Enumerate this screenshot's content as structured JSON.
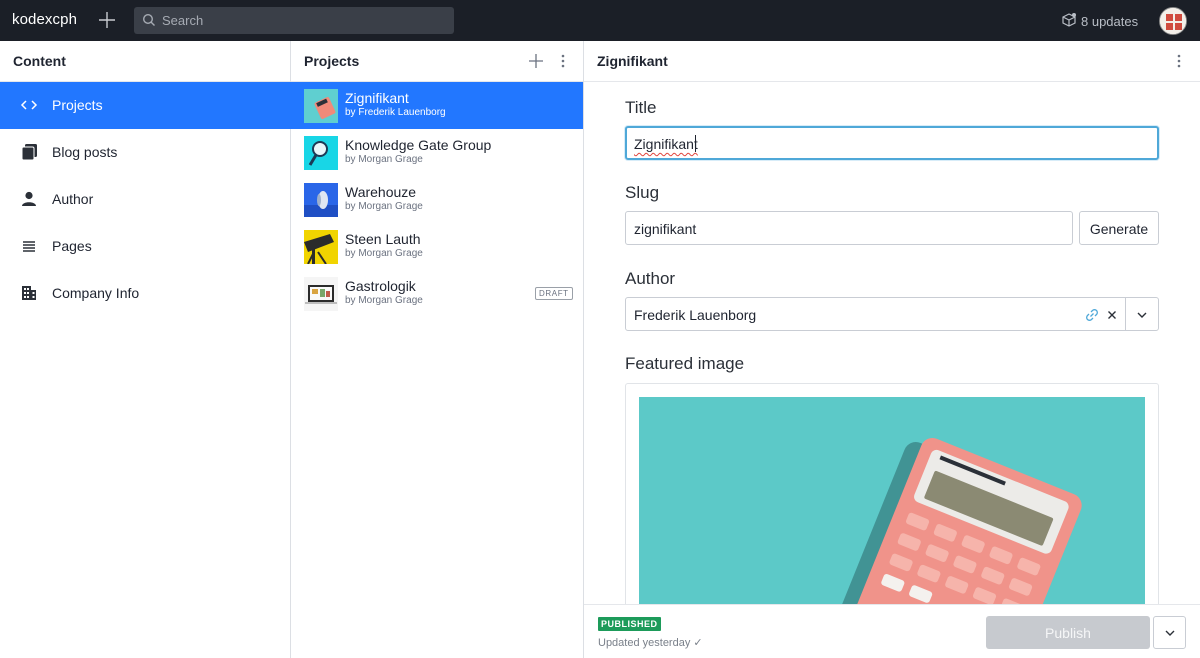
{
  "topbar": {
    "brand": "kodexcph",
    "search_placeholder": "Search",
    "updates": "8 updates"
  },
  "content_pane": {
    "title": "Content",
    "items": [
      {
        "label": "Projects",
        "icon": "code-icon",
        "active": true
      },
      {
        "label": "Blog posts",
        "icon": "documents-icon",
        "active": false
      },
      {
        "label": "Author",
        "icon": "user-icon",
        "active": false
      },
      {
        "label": "Pages",
        "icon": "list-icon",
        "active": false
      },
      {
        "label": "Company Info",
        "icon": "building-icon",
        "active": false
      }
    ]
  },
  "projects_pane": {
    "title": "Projects",
    "items": [
      {
        "title": "Zignifikant",
        "author": "by Frederik Lauenborg",
        "active": true,
        "status": ""
      },
      {
        "title": "Knowledge Gate Group",
        "author": "by Morgan Grage",
        "active": false,
        "status": ""
      },
      {
        "title": "Warehouze",
        "author": "by Morgan Grage",
        "active": false,
        "status": ""
      },
      {
        "title": "Steen Lauth",
        "author": "by Morgan Grage",
        "active": false,
        "status": ""
      },
      {
        "title": "Gastrologik",
        "author": "by Morgan Grage",
        "active": false,
        "status": "DRAFT"
      }
    ]
  },
  "editor": {
    "title": "Zignifikant",
    "fields": {
      "title_label": "Title",
      "title_value": "Zignifikant",
      "slug_label": "Slug",
      "slug_value": "zignifikant",
      "generate_label": "Generate",
      "author_label": "Author",
      "author_value": "Frederik Lauenborg",
      "image_label": "Featured image"
    },
    "footer": {
      "status_badge": "PUBLISHED",
      "updated": "Updated yesterday ✓",
      "publish_label": "Publish"
    }
  },
  "colors": {
    "topbar_bg": "#1b1f27",
    "accent": "#2277ff",
    "published": "#1d9b5a"
  }
}
